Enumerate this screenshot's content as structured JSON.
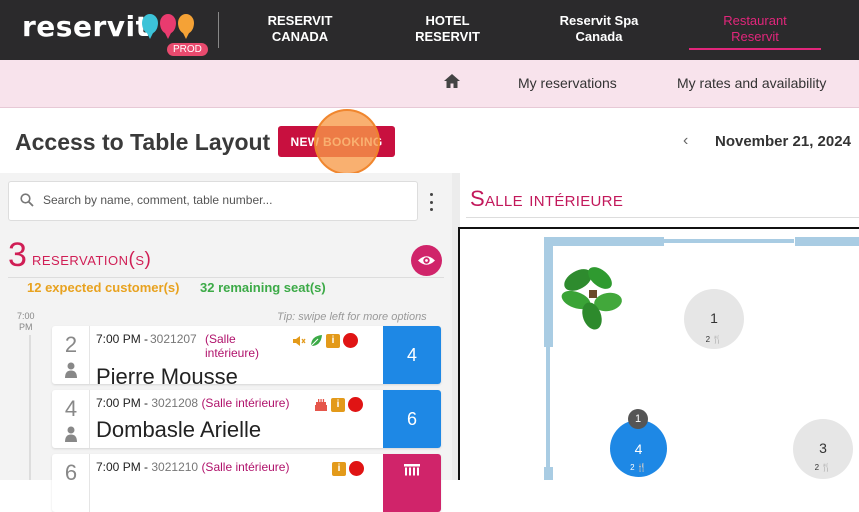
{
  "app": {
    "logo_main": "reserv",
    "logo_it": "it",
    "env_badge": "PROD",
    "nav": [
      {
        "line1": "RESERVIT",
        "line2": "CANADA"
      },
      {
        "line1": "HOTEL",
        "line2": "RESERVIT"
      },
      {
        "line1": "Reservit Spa",
        "line2": "Canada"
      },
      {
        "line1": "Restaurant",
        "line2": "Reservit"
      }
    ]
  },
  "subnav": {
    "my_reservations": "My reservations",
    "my_rates": "My rates and availability"
  },
  "header": {
    "title": "Access to Table Layout",
    "new_booking": "NEW BOOKING",
    "date": "November 21, 2024"
  },
  "search": {
    "placeholder": "Search by name, comment, table number..."
  },
  "summary": {
    "count": "3",
    "label": "reservation(s)",
    "expected": "12 expected customer(s)",
    "remaining": "32 remaining seat(s)",
    "tip": "Tip: swipe left for more options",
    "time_marker_1": "7:00",
    "time_marker_2": "PM"
  },
  "reservations": [
    {
      "covers": "2",
      "time": "7:00 PM -",
      "id": "3021207",
      "room": "(Salle intérieure)",
      "name": "Pierre Mousse",
      "table": "4",
      "table_color": "#1e88e5"
    },
    {
      "covers": "4",
      "time": "7:00 PM -",
      "id": "3021208",
      "room": "(Salle intérieure)",
      "name": "Dombasle Arielle",
      "table": "6",
      "table_color": "#1e88e5"
    },
    {
      "covers": "6",
      "time": "7:00 PM -",
      "id": "3021210",
      "room": "(Salle intérieure)",
      "name": "",
      "table": "",
      "table_color": "#d0246a"
    }
  ],
  "floor": {
    "room_name": "Salle intérieure",
    "tables": [
      {
        "number": "1",
        "seats": "2 🍴"
      },
      {
        "number": "4",
        "seats": "2 🍴"
      },
      {
        "number": "3",
        "seats": "2 🍴"
      }
    ],
    "selected_badge": "1"
  },
  "colors": {
    "brand_pink": "#c8103f",
    "accent_magenta": "#e1267b",
    "table_blue": "#1e88e5",
    "expected_orange": "#e8a21f",
    "remaining_green": "#3caa47"
  }
}
